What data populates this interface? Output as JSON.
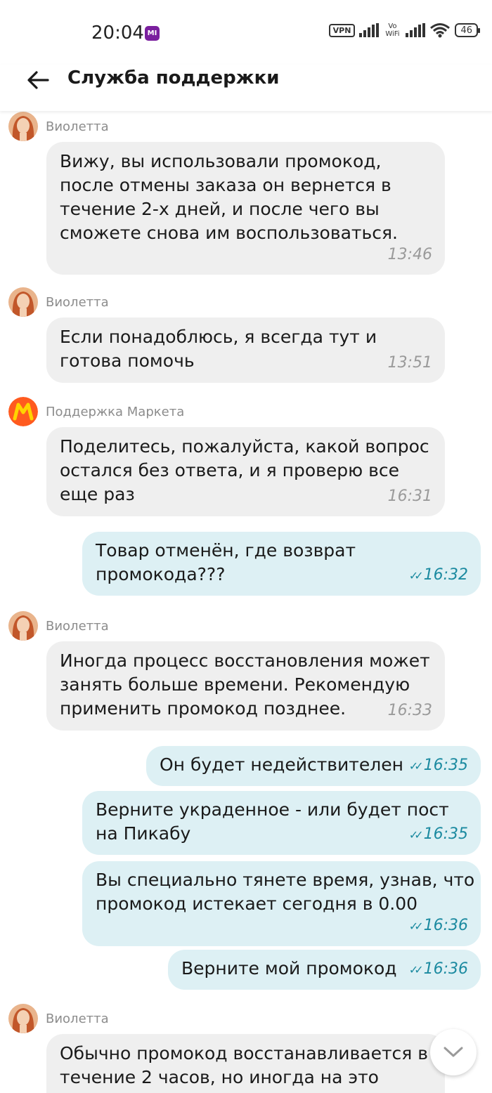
{
  "status_bar": {
    "time": "20:04",
    "mi_label": "MI",
    "vpn_label": "VPN",
    "vowifi_top": "Vo",
    "vowifi_bottom": "WiFi",
    "battery": "46"
  },
  "header": {
    "title": "Служба поддержки"
  },
  "messages": [
    {
      "direction": "in",
      "sender": "Виолетта",
      "lines": [
        "Вижу, вы использовали промокод,",
        "после отмены заказа он вернется в",
        "течение 2-х дней, и после чего вы",
        "сможете снова им воспользоваться."
      ],
      "time": "13:46"
    },
    {
      "direction": "in",
      "sender": "Виолетта",
      "lines": [
        "Если понадоблюсь, я всегда тут и",
        "готова помочь"
      ],
      "time": "13:51"
    },
    {
      "direction": "in",
      "sender": "Поддержка Маркета",
      "lines": [
        "Поделитесь, пожалуйста, какой вопрос",
        "остался без ответа, и я проверю все",
        "еще раз"
      ],
      "time": "16:31"
    },
    {
      "direction": "out",
      "lines": [
        "Товар отменён, где возврат",
        "промокода???"
      ],
      "time": "16:32"
    },
    {
      "direction": "in",
      "sender": "Виолетта",
      "lines": [
        "Иногда процесс восстановления может",
        "занять больше времени. Рекомендую",
        "применить промокод позднее."
      ],
      "time": "16:33"
    },
    {
      "direction": "out",
      "lines": [
        "Он будет недействителен"
      ],
      "time": "16:35"
    },
    {
      "direction": "out",
      "lines": [
        "Верните украденное - или будет пост",
        "на Пикабу"
      ],
      "time": "16:35"
    },
    {
      "direction": "out",
      "lines": [
        "Вы специально тянете время, узнав, что",
        "промокод истекает сегодня в 0.00"
      ],
      "time": "16:36"
    },
    {
      "direction": "out",
      "lines": [
        "Верните мой промокод"
      ],
      "time": "16:36"
    },
    {
      "direction": "in",
      "sender": "Виолетта",
      "lines": [
        "Обычно промокод восстанавливается в",
        "течение 2 часов, но иногда на это"
      ],
      "time": ""
    }
  ],
  "colors": {
    "incoming_bubble": "#efefef",
    "outgoing_bubble": "#ddf0f4",
    "outgoing_time": "#1b8aa0",
    "market_logo_bg": "#ff5a1f",
    "market_logo_letter": "#ffd400"
  },
  "icons": {
    "back": "arrow-left-icon",
    "scroll_down": "chevron-down-icon",
    "read_receipt": "double-check-icon"
  }
}
